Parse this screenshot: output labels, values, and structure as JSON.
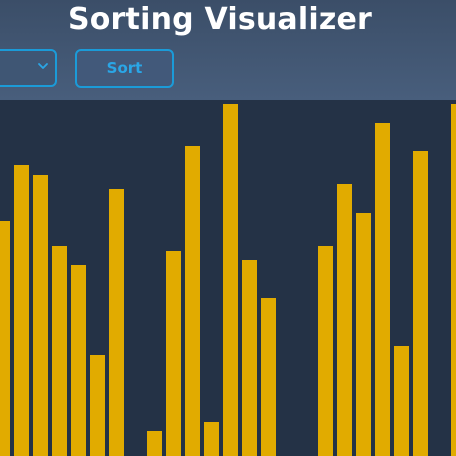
{
  "header": {
    "title": "Sorting Visualizer",
    "sort_label": "Sort",
    "algorithm_select": {
      "selected_value": "",
      "icon": "chevron-down-icon"
    }
  },
  "colors": {
    "header_top": "#3b4e68",
    "header_bottom": "#485e7c",
    "background": "#243246",
    "bar": "#e1ab00",
    "accent": "#1b9bd8",
    "title": "#ffffff"
  },
  "bars": {
    "max_value": 300,
    "values": [
      198,
      245,
      237,
      177,
      161,
      85,
      225,
      0,
      21,
      173,
      261,
      29,
      297,
      165,
      133,
      0,
      0,
      177,
      229,
      205,
      281,
      93,
      257,
      0,
      297
    ]
  }
}
